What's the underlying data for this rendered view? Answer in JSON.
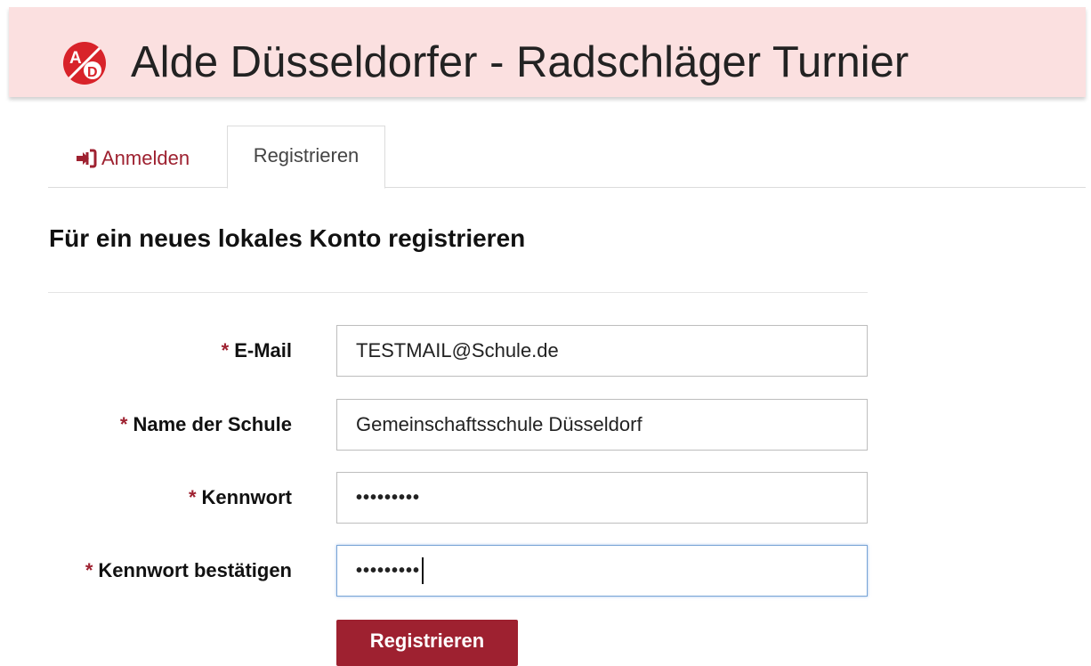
{
  "header": {
    "title": "Alde Düsseldorfer - Radschläger Turnier",
    "logo": {
      "icon": "ad-logo-icon",
      "letter_top": "A",
      "letter_bottom": "D",
      "color": "#d8232a"
    }
  },
  "tabs": {
    "login_label": "Anmelden",
    "login_icon": "sign-in-icon",
    "register_label": "Registrieren"
  },
  "page": {
    "heading": "Für ein neues lokales Konto registrieren"
  },
  "form": {
    "required_marker": "*",
    "email": {
      "label": "E-Mail",
      "value": "TESTMAIL@Schule.de"
    },
    "school": {
      "label": "Name der Schule",
      "value": "Gemeinschaftsschule Düsseldorf"
    },
    "password": {
      "label": "Kennwort",
      "value": "•••••••••"
    },
    "confirm_password": {
      "label": "Kennwort bestätigen",
      "value": "•••••••••"
    },
    "submit_label": "Registrieren"
  },
  "colors": {
    "accent": "#9e2130",
    "header_bg": "#fbe0e0",
    "focus_border": "#78a4d6"
  }
}
